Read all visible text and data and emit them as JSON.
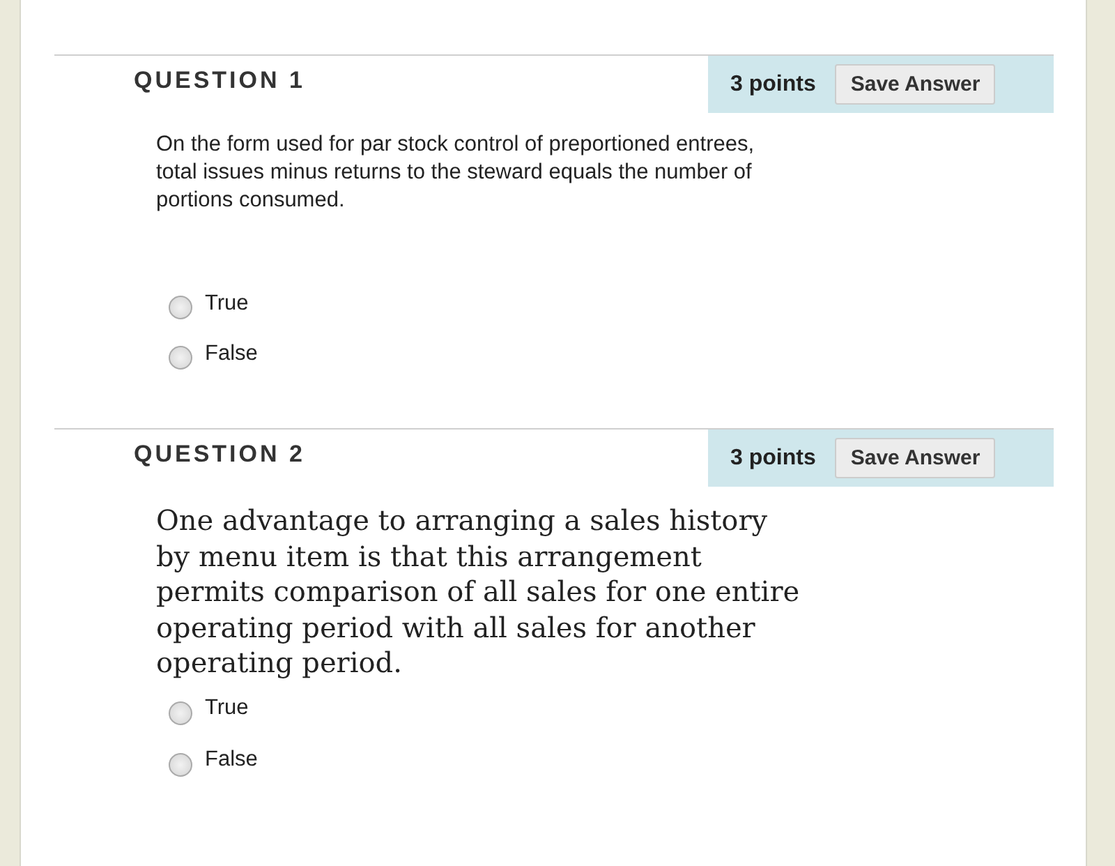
{
  "questions": [
    {
      "title": "QUESTION 1",
      "points": "3 points",
      "save_button": "Save Answer",
      "kind": "sans",
      "text": "On the form used for par stock control of preportioned entrees, total issues minus returns to the steward equals the number of portions consumed.",
      "options": [
        {
          "label": "True",
          "selected": false
        },
        {
          "label": "False",
          "selected": false
        }
      ]
    },
    {
      "title": "QUESTION 2",
      "points": "3 points",
      "save_button": "Save Answer",
      "kind": "serif",
      "text": "One advantage to arranging a sales history by menu item is that this arrangement permits comparison of all sales for one entire operating period with all sales for another operating period.",
      "options": [
        {
          "label": "True",
          "selected": false
        },
        {
          "label": "False",
          "selected": false
        }
      ]
    }
  ]
}
